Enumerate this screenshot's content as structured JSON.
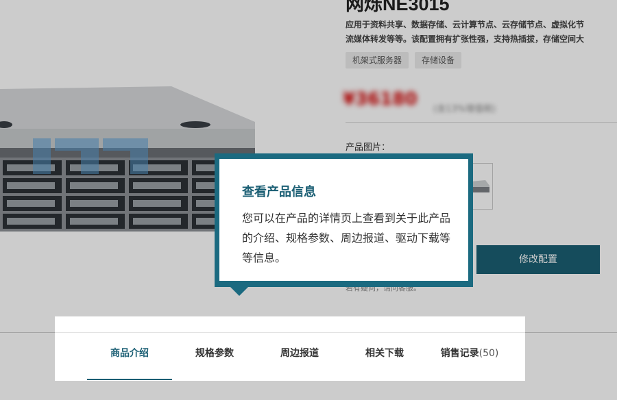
{
  "product": {
    "title": "网烁NE3015",
    "description_line1": "应用于资料共享、数据存储、云计算节点、云存储节点、虚拟化节",
    "description_line2": "流媒体转发等等。该配置拥有扩张性强，支持热插拔，存储空间大",
    "tags": [
      "机架式服务器",
      "存储设备"
    ],
    "price": "¥36180",
    "price_note": "(含13%增值税)",
    "image_label": "产品图片：",
    "watermark": "网烁"
  },
  "actions": {
    "modify_label": "修改配置",
    "help_text": "若有疑问，请问客服。"
  },
  "tooltip": {
    "title": "查看产品信息",
    "body": "您可以在产品的详情页上查看到关于此产品的介绍、规格参数、周边报道、驱动下载等等信息。"
  },
  "tabs": [
    {
      "label": "商品介绍",
      "active": true
    },
    {
      "label": "规格参数",
      "active": false
    },
    {
      "label": "周边报道",
      "active": false
    },
    {
      "label": "相关下载",
      "active": false
    },
    {
      "label": "销售记录",
      "count": "(50)",
      "active": false
    }
  ],
  "colors": {
    "accent": "#1b5f74",
    "tooltip_border": "#1b6a80",
    "price": "#d40000"
  }
}
